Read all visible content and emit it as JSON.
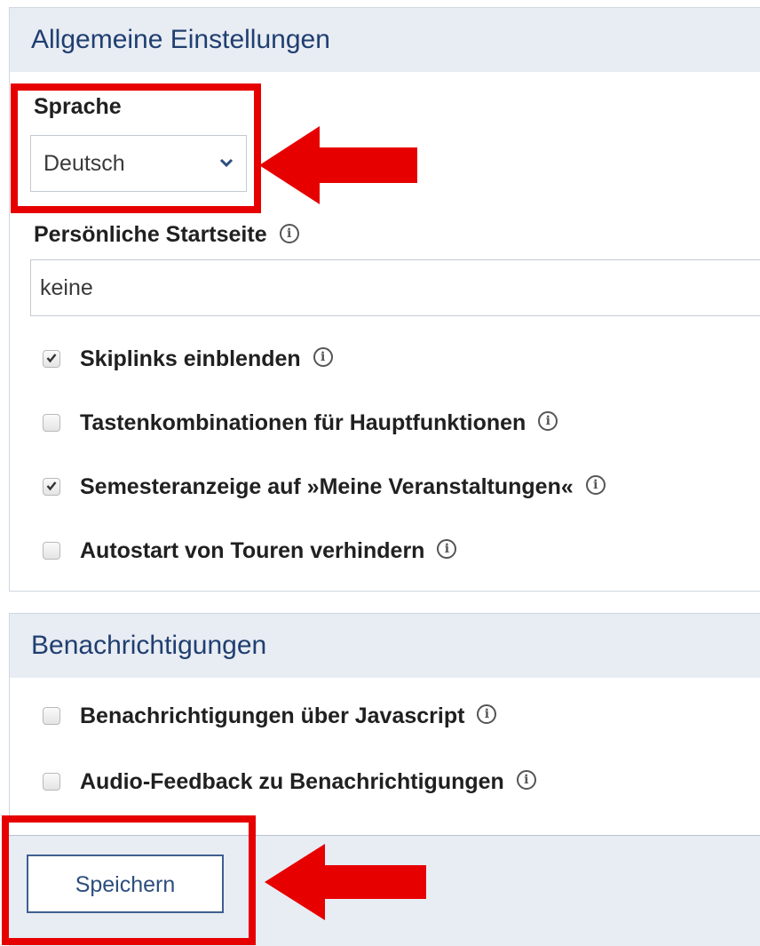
{
  "general": {
    "legend": "Allgemeine Einstellungen",
    "language": {
      "label": "Sprache",
      "selected": "Deutsch",
      "chevron_icon": "chevron-down-icon"
    },
    "homepage": {
      "label": "Persönliche Startseite",
      "value": "keine",
      "info_icon": "info-icon"
    },
    "options": [
      {
        "label": "Skiplinks einblenden",
        "checked": true
      },
      {
        "label": "Tastenkombinationen für Hauptfunktionen",
        "checked": false
      },
      {
        "label": "Semesteranzeige auf »Meine Veranstaltungen«",
        "checked": true
      },
      {
        "label": "Autostart von Touren verhindern",
        "checked": false
      }
    ]
  },
  "notifications": {
    "legend": "Benachrichtigungen",
    "options": [
      {
        "label": "Benachrichtigungen über Javascript",
        "checked": false
      },
      {
        "label": "Audio-Feedback zu Benachrichtigungen",
        "checked": false
      }
    ]
  },
  "footer": {
    "save_label": "Speichern"
  },
  "annotation": {
    "highlight_color": "#e60000",
    "arrow_icon": "arrow-left-icon"
  }
}
